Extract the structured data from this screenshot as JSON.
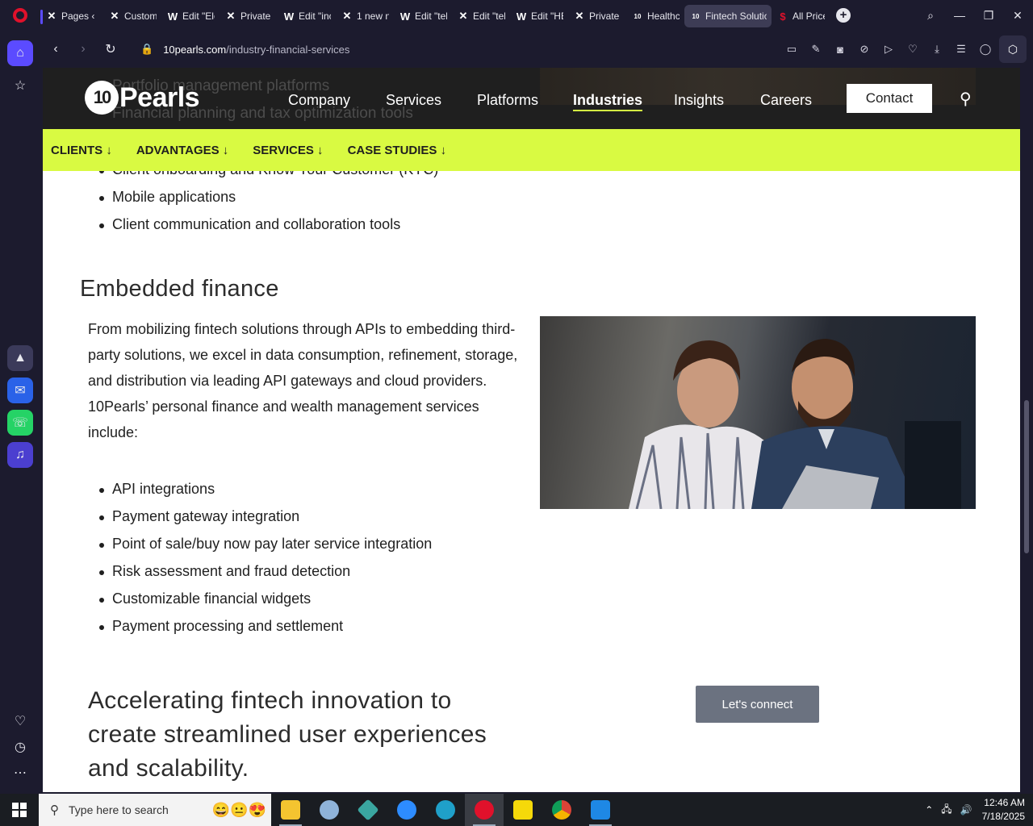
{
  "tabs": [
    {
      "icon": "x-logo-icon",
      "label": "Pages ‹",
      "active": false,
      "color": "#ffffff"
    },
    {
      "icon": "x-logo-icon",
      "label": "Custom",
      "active": false,
      "color": "#ffffff"
    },
    {
      "icon": "wp-icon",
      "label": "Edit \"Ele",
      "active": false,
      "color": "#ffffff"
    },
    {
      "icon": "x-logo-icon",
      "label": "Private",
      "active": false,
      "color": "#ffffff"
    },
    {
      "icon": "wp-icon",
      "label": "Edit \"inc",
      "active": false,
      "color": "#ffffff"
    },
    {
      "icon": "x-logo-icon",
      "label": "1 new n",
      "active": false,
      "color": "#ffffff"
    },
    {
      "icon": "wp-icon",
      "label": "Edit \"tel",
      "active": false,
      "color": "#ffffff"
    },
    {
      "icon": "x-logo-icon",
      "label": "Edit \"tel",
      "active": false,
      "color": "#ffffff"
    },
    {
      "icon": "wp-icon",
      "label": "Edit \"HE",
      "active": false,
      "color": "#ffffff"
    },
    {
      "icon": "x-logo-icon",
      "label": "Private",
      "active": false,
      "color": "#ffffff"
    },
    {
      "icon": "tenpearls-icon",
      "label": "Healthc",
      "active": false,
      "color": "#ffffff"
    },
    {
      "icon": "tenpearls-icon",
      "label": "Fintech Solutio",
      "active": true,
      "color": "#ffffff"
    },
    {
      "icon": "pricing-icon",
      "label": "All Price",
      "active": false,
      "color": "#e0112b"
    }
  ],
  "browser": {
    "url_domain": "10pearls.com",
    "url_path": "/industry-financial-services"
  },
  "site": {
    "logo_text": "Pearls",
    "logo_mark": "10",
    "ghost_line1": "Portfolio management platforms",
    "ghost_line2": "Financial planning and tax optimization tools",
    "nav": [
      {
        "label": "Company",
        "active": false
      },
      {
        "label": "Services",
        "active": false
      },
      {
        "label": "Platforms",
        "active": false
      },
      {
        "label": "Industries",
        "active": true
      },
      {
        "label": "Insights",
        "active": false
      },
      {
        "label": "Careers",
        "active": false
      }
    ],
    "contact_label": "Contact",
    "subnav": [
      "CLIENTS ↓",
      "ADVANTAGES ↓",
      "SERVICES ↓",
      "CASE STUDIES ↓"
    ],
    "accent_color": "#d9fa42"
  },
  "content": {
    "top_items": [
      "Client onboarding and Know Your Customer (KYC)",
      "Mobile applications",
      "Client communication and collaboration tools"
    ],
    "section_title": "Embedded finance",
    "paragraph1": "From mobilizing fintech solutions through APIs to embedding third-party solutions, we excel in data consumption, refinement, storage, and distribution via leading API gateways and cloud providers.",
    "paragraph2": "10Pearls’ personal finance and wealth management services include:",
    "items": [
      "API integrations",
      "Payment gateway integration",
      "Point of sale/buy now pay later service integration",
      "Risk assessment and fraud detection",
      "Customizable financial widgets",
      "Payment processing and settlement"
    ],
    "cta_heading": "Accelerating fintech innovation to create streamlined user experiences and scalability.",
    "cta_button": "Let's connect"
  },
  "taskbar": {
    "search_placeholder": "Type here to search",
    "time": "12:46 AM",
    "date": "7/18/2025"
  }
}
